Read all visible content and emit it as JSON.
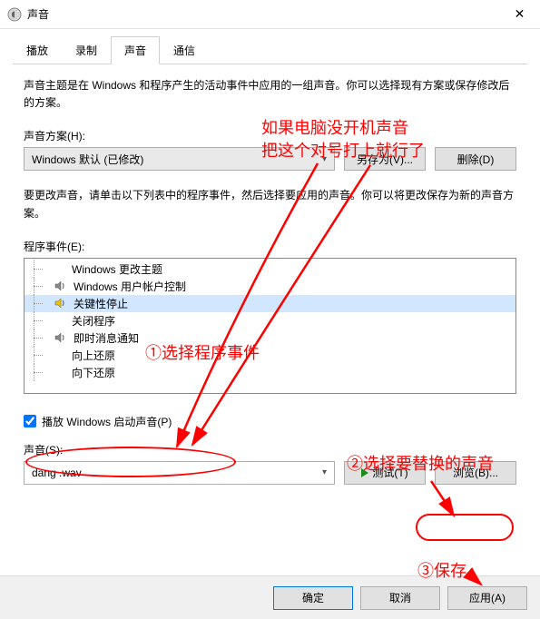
{
  "window": {
    "title": "声音",
    "close_glyph": "✕"
  },
  "tabs": {
    "playback": "播放",
    "recording": "录制",
    "sounds": "声音",
    "communications": "通信"
  },
  "sounds": {
    "desc": "声音主题是在 Windows 和程序产生的活动事件中应用的一组声音。你可以选择现有方案或保存修改后的方案。",
    "scheme_label": "声音方案(H):",
    "scheme_value": "Windows 默认 (已修改)",
    "save_as": "另存为(V)...",
    "delete": "删除(D)",
    "events_desc": "要更改声音，请单击以下列表中的程序事件，然后选择要应用的声音。你可以将更改保存为新的声音方案。",
    "events_label": "程序事件(E):",
    "events": [
      {
        "label": "Windows 更改主题",
        "icon": false,
        "selected": false
      },
      {
        "label": "Windows 用户帐户控制",
        "icon": true,
        "selected": false
      },
      {
        "label": "关键性停止",
        "icon": true,
        "selected": true
      },
      {
        "label": "关闭程序",
        "icon": false,
        "selected": false
      },
      {
        "label": "即时消息通知",
        "icon": true,
        "selected": false
      },
      {
        "label": "向上还原",
        "icon": false,
        "selected": false
      },
      {
        "label": "向下还原",
        "icon": false,
        "selected": false
      }
    ],
    "play_startup_label": "播放 Windows 启动声音(P)",
    "sound_label": "声音(S):",
    "sound_value": "dang .wav",
    "test": "测试(T)",
    "browse": "浏览(B)..."
  },
  "buttons": {
    "ok": "确定",
    "cancel": "取消",
    "apply": "应用(A)"
  },
  "annotations": {
    "top_line1": "如果电脑没开机声音",
    "top_line2": "把这个对号打上就行了",
    "step1": "①选择程序事件",
    "step2": "②选择要替换的声音",
    "step3": "③保存"
  },
  "colors": {
    "annotation": "#ff0000"
  }
}
